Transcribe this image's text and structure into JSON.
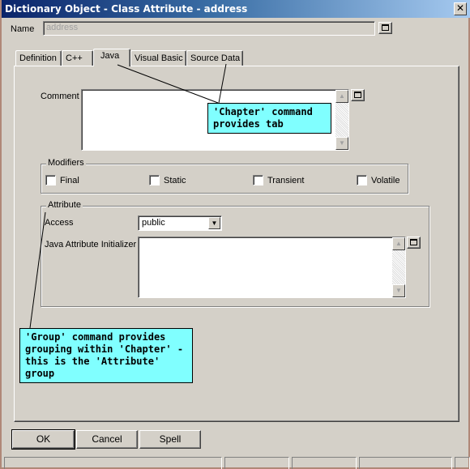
{
  "window": {
    "title": "Dictionary Object - Class Attribute - address",
    "close_icon": "close-icon"
  },
  "name_field": {
    "label": "Name",
    "value": "address",
    "expand_icon": "expand-icon"
  },
  "tabs": [
    {
      "label": "Definition",
      "active": false
    },
    {
      "label": "C++",
      "active": false
    },
    {
      "label": "Java",
      "active": true
    },
    {
      "label": "Visual Basic",
      "active": false
    },
    {
      "label": "Source Data",
      "active": false
    }
  ],
  "comment": {
    "label": "Comment",
    "value": ""
  },
  "modifiers": {
    "legend": "Modifiers",
    "items": [
      {
        "label": "Final",
        "checked": false
      },
      {
        "label": "Static",
        "checked": false
      },
      {
        "label": "Transient",
        "checked": false
      },
      {
        "label": "Volatile",
        "checked": false
      }
    ]
  },
  "attribute_group": {
    "legend": "Attribute",
    "access_label": "Access",
    "access_value": "public",
    "initializer_label": "Java Attribute Initializer",
    "initializer_value": ""
  },
  "callouts": {
    "chapter": "'Chapter' command\nprovides tab",
    "group": "'Group' command provides\ngrouping within 'Chapter' -\nthis is the 'Attribute' group"
  },
  "buttons": {
    "ok": "OK",
    "cancel": "Cancel",
    "spell": "Spell"
  },
  "colors": {
    "callout_bg": "#80ffff",
    "title_start": "#0a246a",
    "title_end": "#a6caf0",
    "face": "#d4d0c8"
  }
}
